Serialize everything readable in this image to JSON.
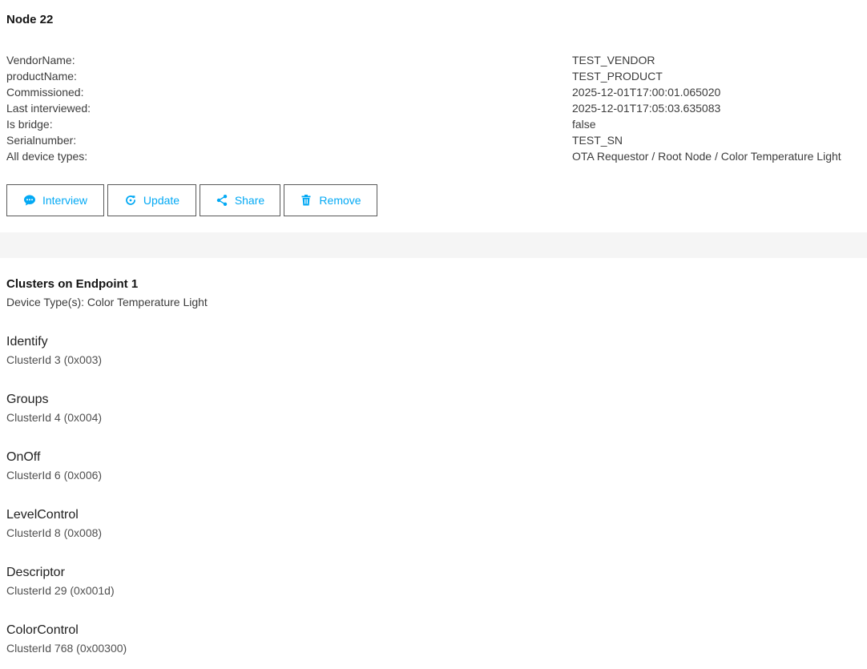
{
  "node": {
    "title": "Node 22"
  },
  "info": [
    {
      "label": "VendorName:",
      "value": "TEST_VENDOR"
    },
    {
      "label": "productName:",
      "value": "TEST_PRODUCT"
    },
    {
      "label": "Commissioned:",
      "value": "2025-12-01T17:00:01.065020"
    },
    {
      "label": "Last interviewed:",
      "value": "2025-12-01T17:05:03.635083"
    },
    {
      "label": "Is bridge:",
      "value": "false"
    },
    {
      "label": "Serialnumber:",
      "value": "TEST_SN"
    },
    {
      "label": "All device types:",
      "value": "OTA Requestor / Root Node / Color Temperature Light"
    }
  ],
  "actions": {
    "interview": {
      "label": "Interview",
      "icon": "chat-icon"
    },
    "update": {
      "label": "Update",
      "icon": "refresh-icon"
    },
    "share": {
      "label": "Share",
      "icon": "share-icon"
    },
    "remove": {
      "label": "Remove",
      "icon": "trash-icon"
    }
  },
  "endpoint": {
    "title": "Clusters on Endpoint 1",
    "subtitle": "Device Type(s): Color Temperature Light"
  },
  "clusters": [
    {
      "name": "Identify",
      "id": "ClusterId 3 (0x003)"
    },
    {
      "name": "Groups",
      "id": "ClusterId 4 (0x004)"
    },
    {
      "name": "OnOff",
      "id": "ClusterId 6 (0x006)"
    },
    {
      "name": "LevelControl",
      "id": "ClusterId 8 (0x008)"
    },
    {
      "name": "Descriptor",
      "id": "ClusterId 29 (0x001d)"
    },
    {
      "name": "ColorControl",
      "id": "ClusterId 768 (0x00300)"
    }
  ],
  "colors": {
    "accent": "#03a9f4",
    "divider": "#f5f5f5",
    "button_border": "#595959"
  }
}
